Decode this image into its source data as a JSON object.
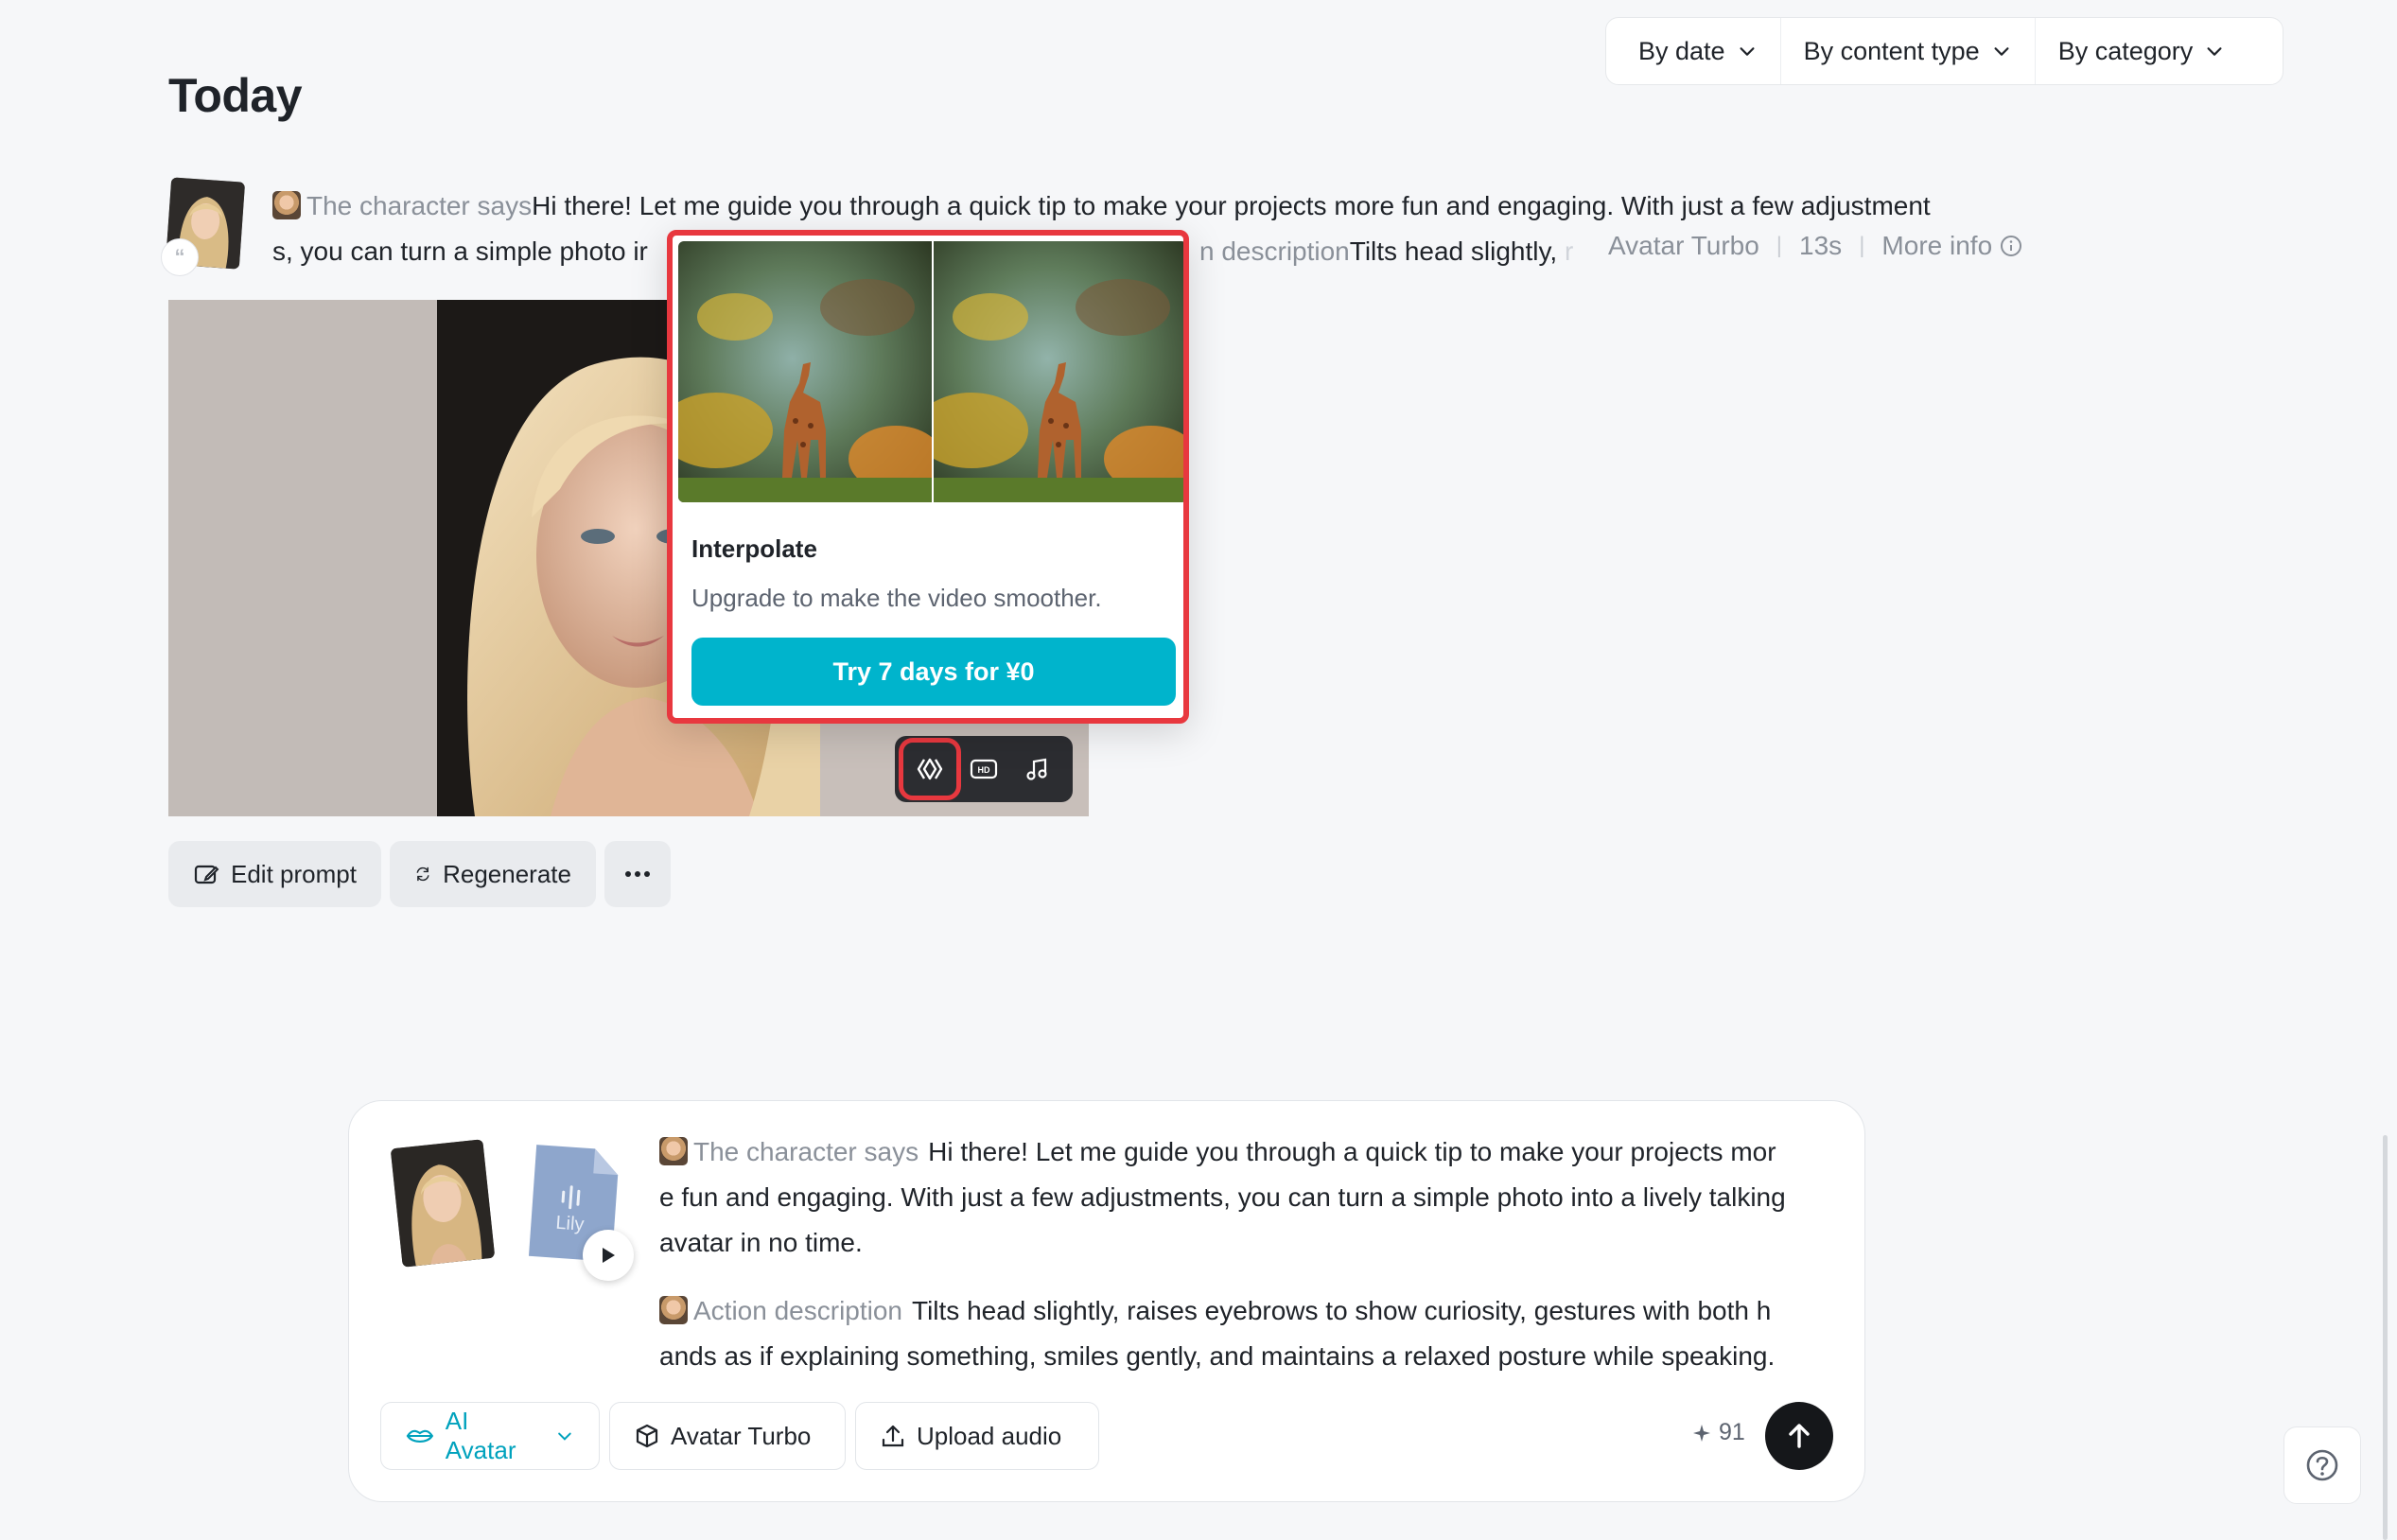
{
  "filters": [
    {
      "label": "By date"
    },
    {
      "label": "By content type"
    },
    {
      "label": "By category"
    }
  ],
  "page_title": "Today",
  "message": {
    "tag": "The character says",
    "line1": "Hi there! Let me guide you through a quick tip to make your projects more fun and engaging. With just a few adjustment",
    "line2_start": "s, you can turn a simple photo ir",
    "line2_tag": "n description",
    "line2_text": "Tilts head slightly,",
    "line2_fade": " r",
    "model": "Avatar Turbo",
    "duration": "13s",
    "more_info": "More info"
  },
  "popup": {
    "title": "Interpolate",
    "description": "Upgrade to make the video smoother.",
    "button": "Try 7 days for ¥0"
  },
  "actions": {
    "edit": "Edit prompt",
    "regenerate": "Regenerate"
  },
  "composer": {
    "audio_label": "Lily",
    "says_tag": "The character says",
    "says_text_1": "Hi there! Let me guide you through a quick tip to make your projects mor",
    "says_text_2": "e fun and engaging. With just a few adjustments, you can turn a simple photo into a lively talking",
    "says_text_3": "avatar in no time.",
    "action_tag": "Action description",
    "action_text_1": "Tilts head slightly, raises eyebrows to show curiosity, gestures with both h",
    "action_text_2": "ands as if explaining something, smiles gently, and maintains a relaxed posture while speaking.",
    "mode": "AI Avatar",
    "model": "Avatar Turbo",
    "upload": "Upload audio",
    "credits": "91"
  },
  "colors": {
    "accent": "#00b4cc",
    "highlight": "#e8383f"
  }
}
